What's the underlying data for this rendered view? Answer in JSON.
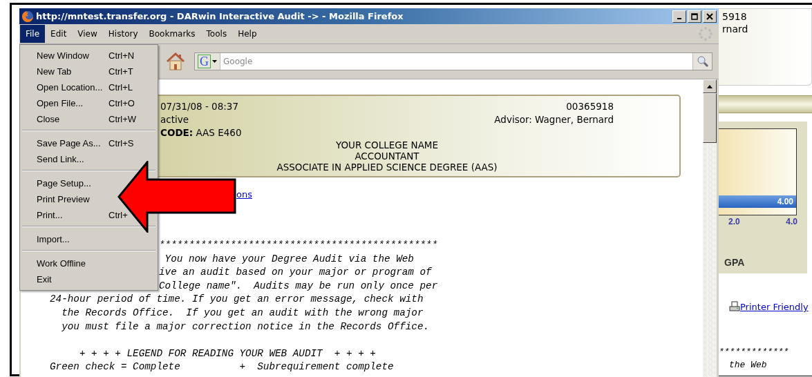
{
  "window": {
    "title": "http://mntest.transfer.org - DARwin Interactive Audit -> - Mozilla Firefox"
  },
  "menu_bar": [
    {
      "label": "File",
      "selected": true
    },
    {
      "label": "Edit",
      "selected": false
    },
    {
      "label": "View",
      "selected": false
    },
    {
      "label": "History",
      "selected": false
    },
    {
      "label": "Bookmarks",
      "selected": false
    },
    {
      "label": "Tools",
      "selected": false
    },
    {
      "label": "Help",
      "selected": false
    }
  ],
  "file_menu": [
    {
      "kind": "item",
      "label": "New Window",
      "shortcut": "Ctrl+N"
    },
    {
      "kind": "item",
      "label": "New Tab",
      "shortcut": "Ctrl+T"
    },
    {
      "kind": "item",
      "label": "Open Location...",
      "shortcut": "Ctrl+L"
    },
    {
      "kind": "item",
      "label": "Open File...",
      "shortcut": "Ctrl+O"
    },
    {
      "kind": "item",
      "label": "Close",
      "shortcut": "Ctrl+W"
    },
    {
      "kind": "separator"
    },
    {
      "kind": "item",
      "label": "Save Page As...",
      "shortcut": "Ctrl+S"
    },
    {
      "kind": "item",
      "label": "Send Link..."
    },
    {
      "kind": "separator"
    },
    {
      "kind": "item",
      "label": "Page Setup..."
    },
    {
      "kind": "item",
      "label": "Print Preview"
    },
    {
      "kind": "item",
      "label": "Print...",
      "shortcut": "Ctrl+"
    },
    {
      "kind": "separator"
    },
    {
      "kind": "item",
      "label": "Import..."
    },
    {
      "kind": "separator"
    },
    {
      "kind": "item",
      "label": "Work Offline"
    },
    {
      "kind": "item",
      "label": "Exit"
    }
  ],
  "search": {
    "engine": "G",
    "placeholder": "Google"
  },
  "audit_header": {
    "timestamp": "07/31/08 - 08:37",
    "status": "active",
    "code_label": "CODE:",
    "code": "AAS E460",
    "student_id": "00365918",
    "advisor": "Advisor: Wagner, Bernard",
    "center_lines": [
      "YOUR COLLEGE NAME",
      "ACCOUNTANT",
      "ASSOCIATE IN APPLIED SCIENCE DEGREE (AAS)"
    ]
  },
  "link_fragment": "ons",
  "audit_text": [
    {
      "kind": "partial",
      "text": "***********************************************"
    },
    {
      "kind": "partial",
      "text": " You now have your Degree Audit via the Web"
    },
    {
      "kind": "partial",
      "text": "ive an audit based on your major or program of"
    },
    {
      "kind": "partial",
      "text": "College name\".  Audits may be run only once per"
    },
    {
      "kind": "full",
      "text": "24-hour period of time. If you get an error message, check with"
    },
    {
      "kind": "full",
      "text": "  the Records Office.  If you get an audit with the wrong major"
    },
    {
      "kind": "full",
      "text": "  you must file a major correction notice in the Records Office."
    },
    {
      "kind": "spaced",
      "text": "     + + + + LEGEND FOR READING YOUR WEB AUDIT  + + + +"
    },
    {
      "kind": "full",
      "text": "Green check = Complete          +  Subrequirement complete"
    }
  ],
  "background_window": {
    "id_fragment": "5918",
    "advisor_fragment": "rnard",
    "bar_value": "4.00",
    "ticks": [
      "2.0",
      "4.0"
    ],
    "chart_label": "GPA",
    "printer_link": "Printer Friendly",
    "rule_fragment": "*************",
    "text_fragment": "the Web"
  }
}
